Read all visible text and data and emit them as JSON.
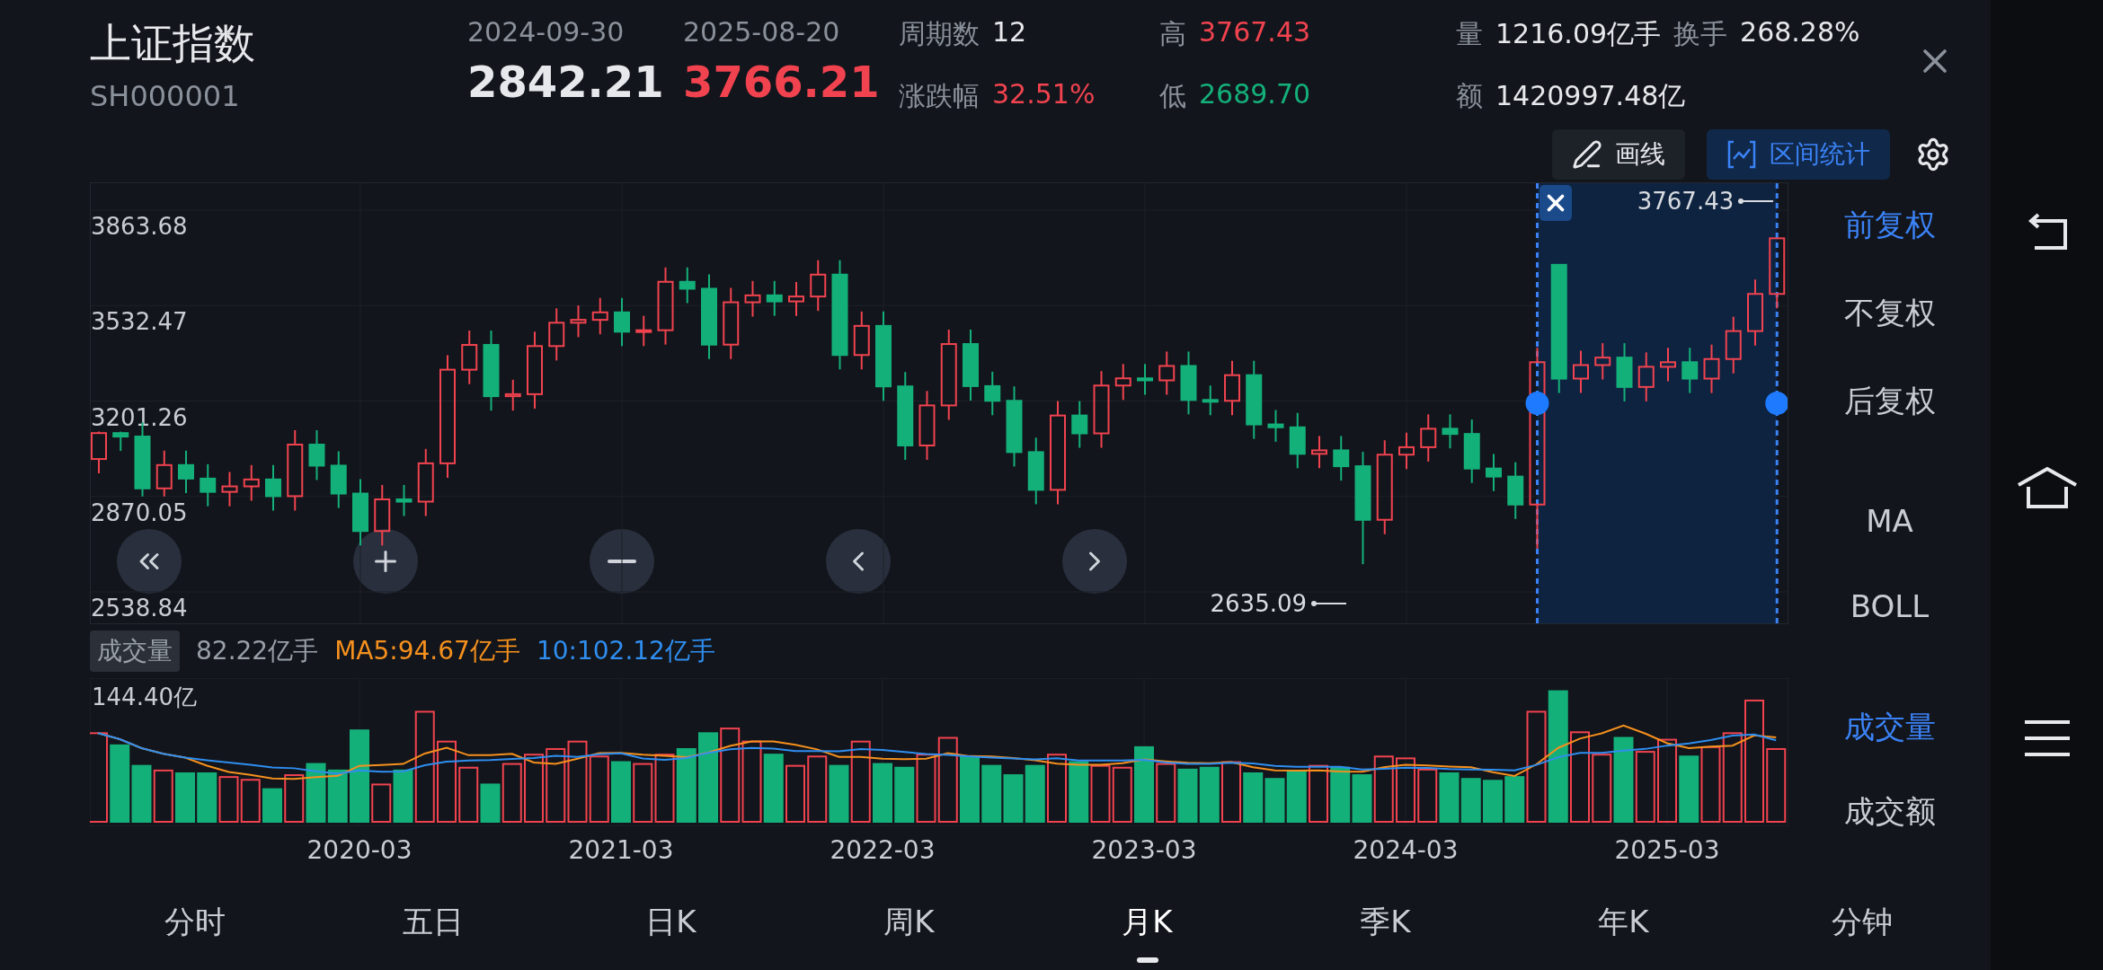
{
  "header": {
    "title": "上证指数",
    "code": "SH000001",
    "quotes": [
      {
        "date": "2024-09-30",
        "price": "2842.21",
        "color": "#e6e8ec"
      },
      {
        "date": "2025-08-20",
        "price": "3766.21",
        "color": "#f0434f"
      }
    ],
    "stat_columns": [
      [
        [
          {
            "label": "周期数",
            "value": "12",
            "color": "#e6e8ec"
          }
        ],
        [
          {
            "label": "涨跌幅",
            "value": "32.51%",
            "color": "#f0434f"
          }
        ]
      ],
      [
        [
          {
            "label": "高",
            "value": "3767.43",
            "color": "#f0434f"
          }
        ],
        [
          {
            "label": "低",
            "value": "2689.70",
            "color": "#14b07a"
          }
        ]
      ],
      [
        [
          {
            "label": "量",
            "value": "1216.09亿手",
            "color": "#e6e8ec"
          },
          {
            "label": "换手",
            "value": "268.28%",
            "color": "#e6e8ec"
          }
        ],
        [
          {
            "label": "额",
            "value": "1420997.48亿",
            "color": "#e6e8ec"
          }
        ]
      ]
    ]
  },
  "toolbar": [
    {
      "label": "画线",
      "kind": "draw",
      "selected": false
    },
    {
      "label": "区间统计",
      "kind": "range",
      "selected": true
    }
  ],
  "chart": {
    "range_high": "3767.43",
    "range_low": "2635.09",
    "chart_data": {
      "type": "candlestick",
      "ylim": [
        2538.84,
        3863.68
      ],
      "yticks": [
        3863.68,
        3532.47,
        3201.26,
        2870.05,
        2538.84
      ],
      "grid": true,
      "ohlc": [
        [
          3000,
          3095,
          2950,
          3090
        ],
        [
          3090,
          3095,
          3028,
          3078
        ],
        [
          3078,
          3128,
          2870,
          2898
        ],
        [
          2898,
          3029,
          2870,
          2979
        ],
        [
          2979,
          3029,
          2882,
          2932
        ],
        [
          2932,
          2982,
          2836,
          2886
        ],
        [
          2886,
          2955,
          2836,
          2905
        ],
        [
          2905,
          2979,
          2855,
          2929
        ],
        [
          2929,
          2979,
          2821,
          2871
        ],
        [
          2871,
          3100,
          2821,
          3050
        ],
        [
          3050,
          3100,
          2927,
          2977
        ],
        [
          2977,
          3027,
          2830,
          2880
        ],
        [
          2880,
          2930,
          2700,
          2750
        ],
        [
          2750,
          2910,
          2700,
          2860
        ],
        [
          2860,
          2910,
          2802,
          2852
        ],
        [
          2852,
          3035,
          2802,
          2985
        ],
        [
          2985,
          3360,
          2935,
          3310
        ],
        [
          3310,
          3446,
          3260,
          3396
        ],
        [
          3396,
          3446,
          3168,
          3218
        ],
        [
          3218,
          3275,
          3168,
          3225
        ],
        [
          3225,
          3442,
          3175,
          3392
        ],
        [
          3392,
          3523,
          3342,
          3473
        ],
        [
          3473,
          3533,
          3423,
          3483
        ],
        [
          3483,
          3559,
          3433,
          3509
        ],
        [
          3509,
          3559,
          3392,
          3442
        ],
        [
          3442,
          3497,
          3392,
          3447
        ],
        [
          3447,
          3665,
          3397,
          3615
        ],
        [
          3615,
          3665,
          3541,
          3591
        ],
        [
          3591,
          3641,
          3347,
          3397
        ],
        [
          3397,
          3594,
          3347,
          3544
        ],
        [
          3544,
          3618,
          3494,
          3568
        ],
        [
          3568,
          3618,
          3497,
          3547
        ],
        [
          3547,
          3614,
          3497,
          3564
        ],
        [
          3564,
          3690,
          3514,
          3640
        ],
        [
          3640,
          3690,
          3311,
          3361
        ],
        [
          3361,
          3512,
          3311,
          3462
        ],
        [
          3462,
          3512,
          3202,
          3252
        ],
        [
          3252,
          3302,
          2997,
          3047
        ],
        [
          3047,
          3236,
          2997,
          3186
        ],
        [
          3186,
          3449,
          3136,
          3399
        ],
        [
          3399,
          3449,
          3203,
          3253
        ],
        [
          3253,
          3303,
          3152,
          3202
        ],
        [
          3202,
          3252,
          2974,
          3024
        ],
        [
          3024,
          3074,
          2843,
          2893
        ],
        [
          2893,
          3201,
          2843,
          3151
        ],
        [
          3151,
          3201,
          3039,
          3089
        ],
        [
          3089,
          3305,
          3039,
          3255
        ],
        [
          3255,
          3330,
          3205,
          3280
        ],
        [
          3280,
          3330,
          3223,
          3273
        ],
        [
          3273,
          3373,
          3223,
          3323
        ],
        [
          3323,
          3373,
          3155,
          3205
        ],
        [
          3205,
          3255,
          3152,
          3202
        ],
        [
          3202,
          3341,
          3152,
          3291
        ],
        [
          3291,
          3341,
          3070,
          3120
        ],
        [
          3120,
          3170,
          3060,
          3110
        ],
        [
          3110,
          3160,
          2968,
          3018
        ],
        [
          3018,
          3080,
          2968,
          3030
        ],
        [
          3030,
          3080,
          2925,
          2975
        ],
        [
          2975,
          3025,
          2635,
          2789
        ],
        [
          2789,
          3065,
          2739,
          3015
        ],
        [
          3015,
          3091,
          2965,
          3041
        ],
        [
          3041,
          3155,
          2991,
          3105
        ],
        [
          3105,
          3155,
          3037,
          3087
        ],
        [
          3087,
          3137,
          2917,
          2967
        ],
        [
          2967,
          3017,
          2889,
          2939
        ],
        [
          2939,
          2989,
          2792,
          2842
        ],
        [
          2842,
          3386,
          2689,
          3336
        ],
        [
          3674,
          3674,
          3229,
          3279
        ],
        [
          3279,
          3376,
          3229,
          3326
        ],
        [
          3326,
          3402,
          3276,
          3352
        ],
        [
          3352,
          3402,
          3200,
          3250
        ],
        [
          3250,
          3370,
          3200,
          3320
        ],
        [
          3320,
          3386,
          3270,
          3336
        ],
        [
          3336,
          3386,
          3229,
          3279
        ],
        [
          3279,
          3397,
          3229,
          3347
        ],
        [
          3347,
          3494,
          3297,
          3444
        ],
        [
          3444,
          3623,
          3394,
          3573
        ],
        [
          3573,
          3767,
          3523,
          3766
        ]
      ]
    }
  },
  "volume": {
    "tag": "成交量",
    "value": "82.22亿手",
    "ma5": "MA5:94.67亿手",
    "ma10": "10:102.12亿手",
    "max": "144.40亿"
  },
  "price_options": [
    {
      "label": "前复权",
      "selected": true
    },
    {
      "label": "不复权",
      "selected": false
    },
    {
      "label": "后复权",
      "selected": false
    }
  ],
  "x_labels": [
    "2020-03",
    "2021-03",
    "2022-03",
    "2023-03",
    "2024-03",
    "2025-03"
  ],
  "indicators": [
    "MA",
    "BOLL"
  ],
  "volume_options": [
    {
      "label": "成交量",
      "selected": true
    },
    {
      "label": "成交额",
      "selected": false
    }
  ],
  "tabs": [
    {
      "label": "分时",
      "selected": false
    },
    {
      "label": "五日",
      "selected": false
    },
    {
      "label": "日K",
      "selected": false
    },
    {
      "label": "周K",
      "selected": false
    },
    {
      "label": "月K",
      "selected": true
    },
    {
      "label": "季K",
      "selected": false
    },
    {
      "label": "年K",
      "selected": false
    },
    {
      "label": "分钟",
      "selected": false
    }
  ]
}
